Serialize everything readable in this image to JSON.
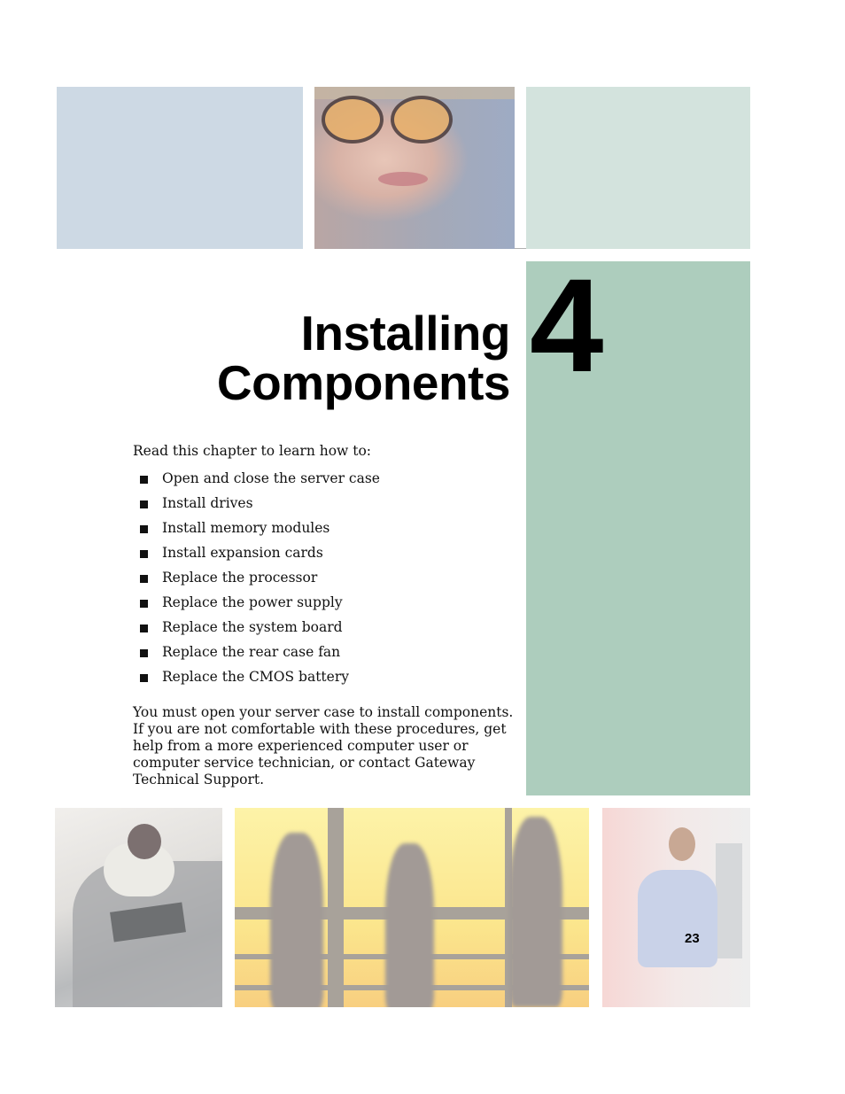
{
  "chapter": {
    "number": "4",
    "title_line1": "Installing",
    "title_line2": "Components"
  },
  "intro": "Read this chapter to learn how to:",
  "bullets": [
    "Open and close the server case",
    "Install drives",
    "Install memory modules",
    "Install expansion cards",
    "Replace the processor",
    "Replace the power supply",
    "Replace the system board",
    "Replace the rear case fan",
    "Replace the CMOS battery"
  ],
  "paragraph": "You must open your server case to install components. If you are not comfortable with these procedures, get help from a more experienced computer user or computer service technician, or contact Gateway Technical Support.",
  "page_number": "23",
  "colors": {
    "top_blue": "#cdd9e4",
    "top_green": "#d3e3dd",
    "side_green": "#adcdbd"
  },
  "images": {
    "top": "woman-with-orange-glasses-photo",
    "bottom_left": "man-at-computer-desk-photo",
    "bottom_center": "silhouettes-walking-photo",
    "bottom_right": "man-with-headphones-photo"
  }
}
